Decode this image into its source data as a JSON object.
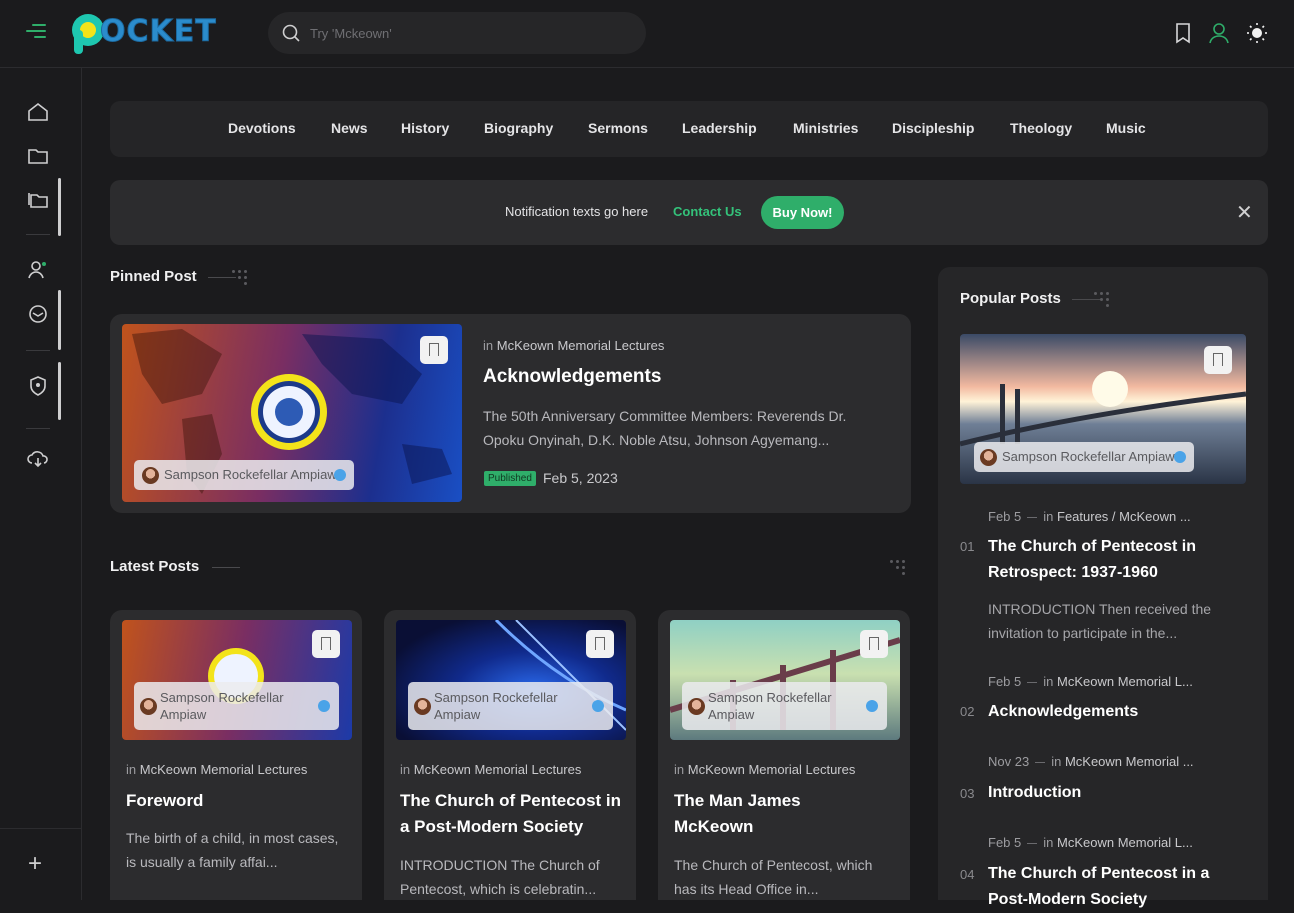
{
  "header": {
    "logo_text": "OCKET",
    "search_placeholder": "Try 'Mckeown'"
  },
  "categories": [
    "Devotions",
    "News",
    "History",
    "Biography",
    "Sermons",
    "Leadership",
    "Ministries",
    "Discipleship",
    "Theology",
    "Music"
  ],
  "notification": {
    "text": "Notification texts go here",
    "link": "Contact Us",
    "button": "Buy Now!",
    "close": "✕"
  },
  "pinned": {
    "section_title": "Pinned Post",
    "in_label": "in",
    "category": "McKeown Memorial Lectures",
    "title": "Acknowledgements",
    "excerpt": "The 50th Anniversary Committee Members: Reverends Dr. Opoku Onyinah, D.K. Noble Atsu, Johnson Agyemang...",
    "author": "Sampson Rockefellar Ampiaw",
    "status": "Published",
    "date": "Feb 5, 2023"
  },
  "latest": {
    "section_title": "Latest Posts",
    "posts": [
      {
        "in_label": "in",
        "category": "McKeown Memorial Lectures",
        "title": "Foreword",
        "excerpt": "The birth of a child, in most cases, is usually a family affai...",
        "author": "Sampson Rockefellar Ampiaw"
      },
      {
        "in_label": "in",
        "category": "McKeown Memorial Lectures",
        "title": "The Church of Pentecost in a Post-Modern Society",
        "excerpt": "INTRODUCTION The Church of Pentecost, which is celebratin...",
        "author": "Sampson Rockefellar Ampiaw"
      },
      {
        "in_label": "in",
        "category": "McKeown Memorial Lectures",
        "title": "The Man James McKeown",
        "excerpt": "The Church of Pentecost, which has its Head Office in...",
        "author": "Sampson Rockefellar Ampiaw"
      }
    ]
  },
  "popular": {
    "section_title": "Popular Posts",
    "featured_author": "Sampson Rockefellar Ampiaw",
    "items": [
      {
        "num": "01",
        "date": "Feb 5",
        "in_label": "in",
        "category": "Features / McKeown ...",
        "title": "The Church of Pentecost in Retrospect: 1937-1960",
        "excerpt": "INTRODUCTION Then  received the invitation to participate in the..."
      },
      {
        "num": "02",
        "date": "Feb 5",
        "in_label": "in",
        "category": "McKeown Memorial L...",
        "title": "Acknowledgements",
        "excerpt": ""
      },
      {
        "num": "03",
        "date": "Nov 23",
        "in_label": "in",
        "category": "McKeown Memorial ...",
        "title": "Introduction",
        "excerpt": ""
      },
      {
        "num": "04",
        "date": "Feb 5",
        "in_label": "in",
        "category": "McKeown Memorial L...",
        "title": "The Church of Pentecost in a Post-Modern Society",
        "excerpt": ""
      }
    ]
  },
  "colors": {
    "accent": "#2fae6a",
    "logo": "#2b8ccc",
    "background": "#1b1b1d",
    "card": "#2c2c2e"
  }
}
